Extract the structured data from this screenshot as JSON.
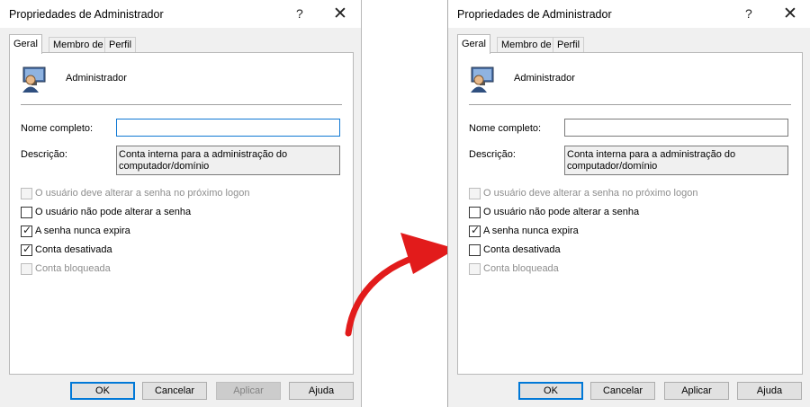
{
  "left": {
    "title": "Propriedades de Administrador",
    "help": "?",
    "close": "✕",
    "tabs": [
      "Geral",
      "Membro de",
      "Perfil"
    ],
    "user_name": "Administrador",
    "full_name_label": "Nome completo:",
    "full_name_value": "",
    "description_label": "Descrição:",
    "description_value": "Conta interna para a administração do computador/domínio",
    "checkboxes": [
      {
        "label": "O usuário deve alterar a senha no próximo logon",
        "checked": false,
        "disabled": true
      },
      {
        "label": "O usuário não pode alterar a senha",
        "checked": false,
        "disabled": false
      },
      {
        "label": "A senha nunca expira",
        "checked": true,
        "disabled": false
      },
      {
        "label": "Conta desativada",
        "checked": true,
        "disabled": false
      },
      {
        "label": "Conta bloqueada",
        "checked": false,
        "disabled": true
      }
    ],
    "buttons": {
      "ok": "OK",
      "cancel": "Cancelar",
      "apply": "Aplicar",
      "help": "Ajuda"
    }
  },
  "right": {
    "title": "Propriedades de Administrador",
    "help": "?",
    "close": "✕",
    "tabs": [
      "Geral",
      "Membro de",
      "Perfil"
    ],
    "user_name": "Administrador",
    "full_name_label": "Nome completo:",
    "full_name_value": "",
    "description_label": "Descrição:",
    "description_value": "Conta interna para a administração do computador/domínio",
    "checkboxes": [
      {
        "label": "O usuário deve alterar a senha no próximo logon",
        "checked": false,
        "disabled": true
      },
      {
        "label": "O usuário não pode alterar a senha",
        "checked": false,
        "disabled": false
      },
      {
        "label": "A senha nunca expira",
        "checked": true,
        "disabled": false
      },
      {
        "label": "Conta desativada",
        "checked": false,
        "disabled": false
      },
      {
        "label": "Conta bloqueada",
        "checked": false,
        "disabled": true
      }
    ],
    "buttons": {
      "ok": "OK",
      "cancel": "Cancelar",
      "apply": "Aplicar",
      "help": "Ajuda"
    }
  },
  "colors": {
    "arrow": "#e21b1b",
    "focus": "#0078d7"
  },
  "icons": {
    "user": "user-computer-icon",
    "arrow": "curved-arrow-icon"
  }
}
